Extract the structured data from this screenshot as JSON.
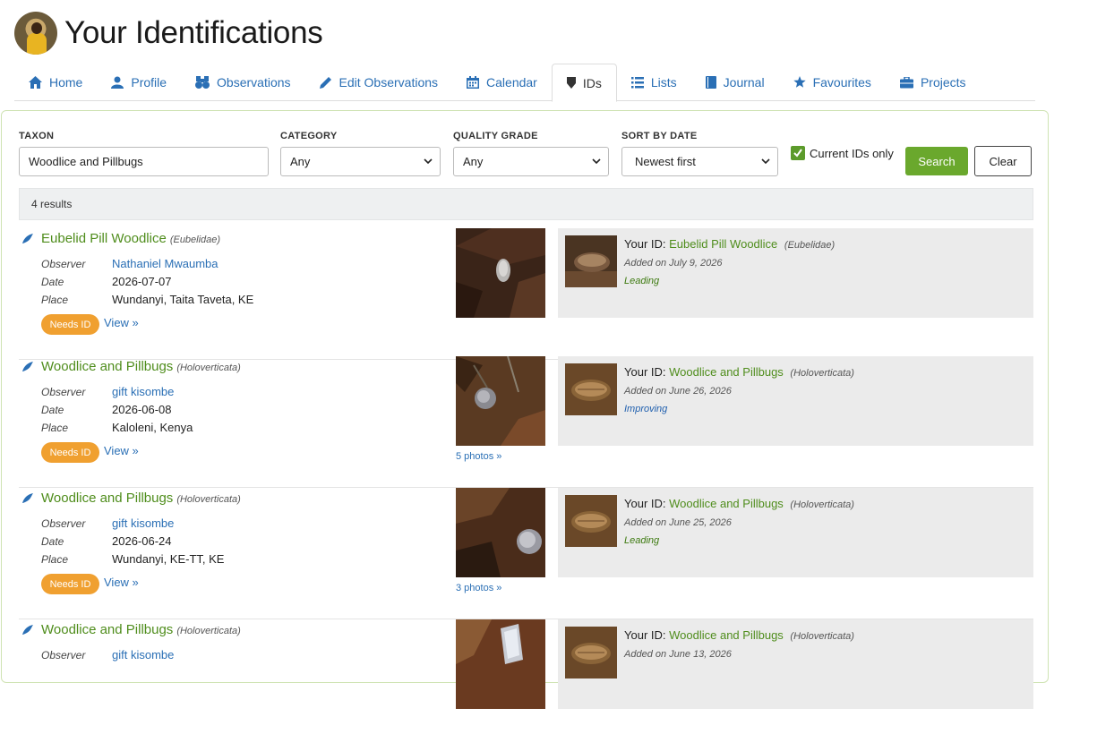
{
  "page": {
    "title": "Your Identifications"
  },
  "tabs": [
    {
      "label": "Home",
      "icon": "home-icon"
    },
    {
      "label": "Profile",
      "icon": "user-icon"
    },
    {
      "label": "Observations",
      "icon": "binoculars-icon"
    },
    {
      "label": "Edit Observations",
      "icon": "pencil-icon"
    },
    {
      "label": "Calendar",
      "icon": "calendar-icon"
    },
    {
      "label": "IDs",
      "icon": "tag-icon",
      "active": true
    },
    {
      "label": "Lists",
      "icon": "list-icon"
    },
    {
      "label": "Journal",
      "icon": "book-icon"
    },
    {
      "label": "Favourites",
      "icon": "star-icon"
    },
    {
      "label": "Projects",
      "icon": "briefcase-icon"
    }
  ],
  "filters": {
    "taxon_label": "TAXON",
    "taxon_value": "Woodlice and Pillbugs",
    "category_label": "CATEGORY",
    "category_value": "Any",
    "quality_label": "QUALITY GRADE",
    "quality_value": "Any",
    "sort_label": "SORT BY DATE",
    "sort_value": "Newest first",
    "current_ids_label": "Current IDs only",
    "current_ids_checked": true,
    "search_label": "Search",
    "clear_label": "Clear"
  },
  "results_count": "4 results",
  "labels": {
    "observer": "Observer",
    "date": "Date",
    "place": "Place",
    "view": "View »",
    "your_id": "Your ID:"
  },
  "results": [
    {
      "taxon": "Eubelid Pill Woodlice",
      "sci": "(Eubelidae)",
      "observer": "Nathaniel Mwaumba",
      "date": "2026-07-07",
      "place": "Wundanyi, Taita Taveta, KE",
      "badge": "Needs ID",
      "photos_link": "",
      "id_taxon": "Eubelid Pill Woodlice",
      "id_sci": "(Eubelidae)",
      "added": "Added on July 9, 2026",
      "category": "Leading"
    },
    {
      "taxon": "Woodlice and Pillbugs",
      "sci": "(Holoverticata)",
      "observer": "gift kisombe",
      "date": "2026-06-08",
      "place": "Kaloleni, Kenya",
      "badge": "Needs ID",
      "photos_link": "5 photos »",
      "id_taxon": "Woodlice and Pillbugs",
      "id_sci": "(Holoverticata)",
      "added": "Added on June 26, 2026",
      "category": "Improving"
    },
    {
      "taxon": "Woodlice and Pillbugs",
      "sci": "(Holoverticata)",
      "observer": "gift kisombe",
      "date": "2026-06-24",
      "place": "Wundanyi, KE-TT, KE",
      "badge": "Needs ID",
      "photos_link": "3 photos »",
      "id_taxon": "Woodlice and Pillbugs",
      "id_sci": "(Holoverticata)",
      "added": "Added on June 25, 2026",
      "category": "Leading"
    },
    {
      "taxon": "Woodlice and Pillbugs",
      "sci": "(Holoverticata)",
      "observer": "gift kisombe",
      "date": "",
      "place": "",
      "badge": "",
      "photos_link": "",
      "id_taxon": "Woodlice and Pillbugs",
      "id_sci": "(Holoverticata)",
      "added": "Added on June 13, 2026",
      "category": ""
    }
  ],
  "colors": {
    "accent_green": "#6aa82d",
    "link_blue": "#2a6fb5",
    "badge_orange": "#f0a030"
  }
}
